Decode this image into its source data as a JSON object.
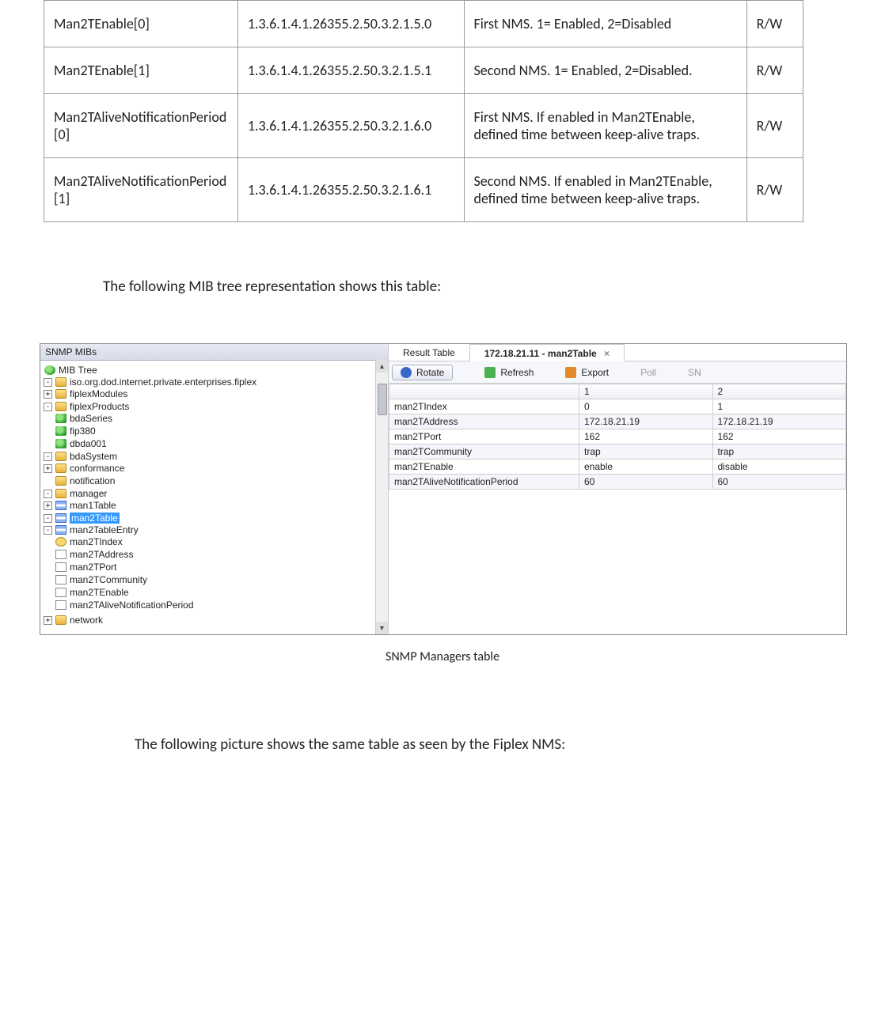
{
  "mib_table": {
    "rows": [
      {
        "name": "Man2TEnable[0]",
        "oid": "1.3.6.1.4.1.26355.2.50.3.2.1.5.0",
        "desc": "First NMS. 1= Enabled, 2=Disabled",
        "access": "R/W"
      },
      {
        "name": "Man2TEnable[1]",
        "oid": "1.3.6.1.4.1.26355.2.50.3.2.1.5.1",
        "desc": "Second NMS. 1= Enabled, 2=Disabled.",
        "access": "R/W"
      },
      {
        "name": "Man2TAliveNotificationPeriod[0]",
        "oid": "1.3.6.1.4.1.26355.2.50.3.2.1.6.0",
        "desc": "First NMS. If enabled in Man2TEnable, defined time between keep-alive traps.",
        "access": "R/W"
      },
      {
        "name": "Man2TAliveNotificationPeriod[1]",
        "oid": "1.3.6.1.4.1.26355.2.50.3.2.1.6.1",
        "desc": "Second NMS. If enabled in Man2TEnable, defined time between keep-alive traps.",
        "access": "R/W"
      }
    ]
  },
  "text": {
    "intro": "The following MIB tree representation shows this table:",
    "caption": "SNMP Managers table",
    "outro": "The following picture shows the same table as seen by the Fiplex NMS:"
  },
  "shot": {
    "tree": {
      "title": "SNMP MIBs",
      "root": "MIB Tree",
      "path": "iso.org.dod.internet.private.enterprises.fiplex",
      "fiplexModules": "fiplexModules",
      "fiplexProducts": "fiplexProducts",
      "bdaSeries": "bdaSeries",
      "fip380": "fip380",
      "dbda001": "dbda001",
      "bdaSystem": "bdaSystem",
      "conformance": "conformance",
      "notification": "notification",
      "manager": "manager",
      "man1Table": "man1Table",
      "man2Table": "man2Table",
      "man2TableEntry": "man2TableEntry",
      "man2TIndex": "man2TIndex",
      "man2TAddress": "man2TAddress",
      "man2TPort": "man2TPort",
      "man2TCommunity": "man2TCommunity",
      "man2TEnable": "man2TEnable",
      "man2TAliveNotificationPeriod": "man2TAliveNotificationPeriod",
      "network": "network"
    },
    "result": {
      "tab_left": "Result Table",
      "tab_active": "172.18.21.11 - man2Table",
      "toolbar": {
        "rotate": "Rotate",
        "refresh": "Refresh",
        "export": "Export",
        "poll": "Poll",
        "sn": "SN"
      },
      "cols": {
        "c1": "1",
        "c2": "2"
      },
      "rows": [
        {
          "label": "man2TIndex",
          "v1": "0",
          "v2": "1"
        },
        {
          "label": "man2TAddress",
          "v1": "172.18.21.19",
          "v2": "172.18.21.19"
        },
        {
          "label": "man2TPort",
          "v1": "162",
          "v2": "162"
        },
        {
          "label": "man2TCommunity",
          "v1": "trap",
          "v2": "trap"
        },
        {
          "label": "man2TEnable",
          "v1": "enable",
          "v2": "disable"
        },
        {
          "label": "man2TAliveNotificationPeriod",
          "v1": "60",
          "v2": "60"
        }
      ]
    }
  }
}
